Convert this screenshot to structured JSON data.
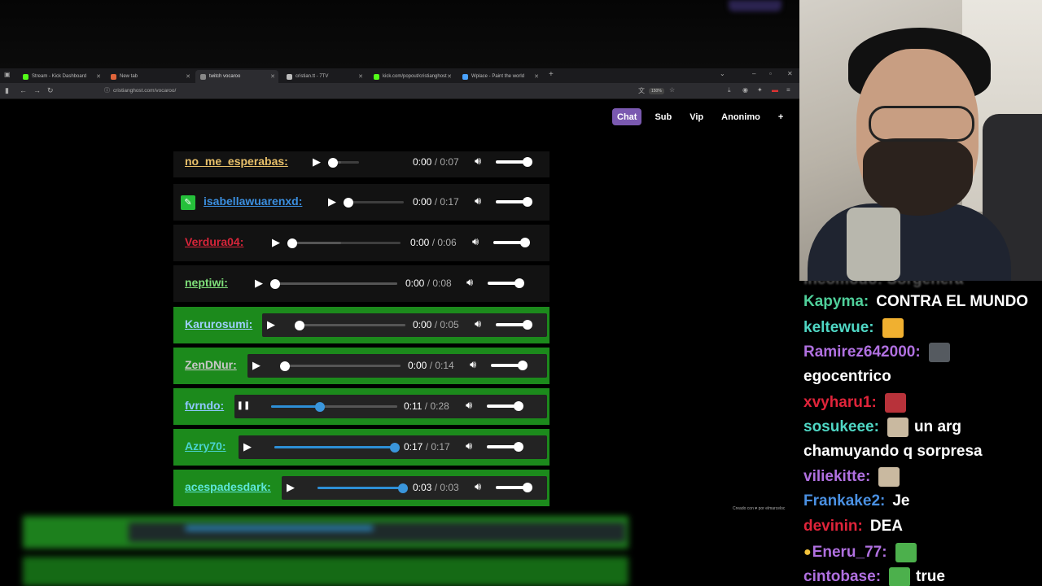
{
  "browser": {
    "tabs": [
      {
        "label": "Stream - Kick Dashboard",
        "color": "#53fc18"
      },
      {
        "label": "New tab",
        "color": "#e0643a"
      },
      {
        "label": "twitch vocaroo",
        "color": "#888888",
        "active": true
      },
      {
        "label": "cristian.tt - 7TV",
        "color": "#bbbbbb"
      },
      {
        "label": "kick.com/popout/cristianghost",
        "color": "#53fc18"
      },
      {
        "label": "Wplace - Paint the world",
        "color": "#4aa3ff"
      }
    ],
    "new_tab_glyph": "+",
    "url": "cristianghost.com/vocaroo/",
    "zoom": "150%"
  },
  "header_buttons": [
    {
      "label": "Chat",
      "active": true
    },
    {
      "label": "Sub",
      "active": false
    },
    {
      "label": "Vip",
      "active": false
    },
    {
      "label": "Anonimo",
      "active": false
    },
    {
      "label": "+",
      "active": false
    }
  ],
  "audio_rows": [
    {
      "user": "no_me_esperabas:",
      "user_color": "#e8c06a",
      "style": "dark",
      "state": "paused",
      "current": "0:00",
      "duration": "0:07",
      "progress": 0.0,
      "buffered": 0.3
    },
    {
      "user": "isabellawuarenxd:",
      "user_color": "#3b8fe0",
      "style": "dark",
      "badge": true,
      "state": "paused",
      "current": "0:00",
      "duration": "0:17",
      "progress": 0.0,
      "buffered": 0.0
    },
    {
      "user": "Verdura04:",
      "user_color": "#d8253a",
      "style": "dark",
      "state": "paused",
      "current": "0:00",
      "duration": "0:06",
      "progress": 0.0,
      "buffered": 0.45
    },
    {
      "user": "neptiwi:",
      "user_color": "#7fe07a",
      "style": "dark",
      "state": "paused",
      "current": "0:00",
      "duration": "0:08",
      "progress": 0.0,
      "buffered": 1.0
    },
    {
      "user": "Karurosumi:",
      "user_color": "#9fd0ff",
      "style": "green",
      "state": "paused",
      "current": "0:00",
      "duration": "0:05",
      "progress": 0.0,
      "buffered": 1.0
    },
    {
      "user": "ZenDNur:",
      "user_color": "#c8c8c8",
      "style": "green",
      "state": "paused",
      "current": "0:00",
      "duration": "0:14",
      "progress": 0.0,
      "buffered": 1.0
    },
    {
      "user": "fvrndo:",
      "user_color": "#8fc7ff",
      "style": "green",
      "state": "playing",
      "current": "0:11",
      "duration": "0:28",
      "progress": 0.39,
      "buffered": 1.0
    },
    {
      "user": "Azry70:",
      "user_color": "#4ad3d0",
      "style": "green",
      "state": "paused",
      "current": "0:17",
      "duration": "0:17",
      "progress": 1.0,
      "buffered": 1.0
    },
    {
      "user": "acespadesdark:",
      "user_color": "#5ee6d8",
      "style": "green",
      "state": "paused",
      "current": "0:03",
      "duration": "0:03",
      "progress": 1.0,
      "buffered": 1.0
    }
  ],
  "credit": "Creado con ♥ por elmarceloc",
  "chat": {
    "ghost": "Incomodo: Sorgenera",
    "messages": [
      {
        "user": "Kapyma:",
        "color": "#4fcf9a",
        "text": "CONTRA EL MUNDO"
      },
      {
        "user": "keltewue:",
        "color": "#4fd6c4",
        "text": "",
        "emote": "surprised-emote"
      },
      {
        "user": "Ramirez642000:",
        "color": "#b070e0",
        "text": "",
        "emote": "hooded-figure-emote"
      },
      {
        "user": "",
        "color": "#ffffff",
        "text": "egocentrico"
      },
      {
        "user": "xvyharu1:",
        "color": "#e0243a",
        "text": "",
        "emote": "red-mask-emote"
      },
      {
        "user": "sosukeee:",
        "color": "#4fd6c4",
        "text": "un arg",
        "emote": "che-emote"
      },
      {
        "user": "",
        "color": "#ffffff",
        "text": "chamuyando q sorpresa"
      },
      {
        "user": "viliekitte:",
        "color": "#b070e0",
        "text": "",
        "emote": "che-emote"
      },
      {
        "user": "Frankake2:",
        "color": "#4a90e2",
        "text": "Je"
      },
      {
        "user": "devinin:",
        "color": "#e0243a",
        "text": "DEA"
      },
      {
        "user": "Eneru_77:",
        "color": "#b070e0",
        "text": "",
        "emote": "green-face-emote",
        "prefix_emote": true
      },
      {
        "user": "cintobase:",
        "color": "#b070e0",
        "text": "true",
        "emote": "green-face-emote"
      }
    ]
  }
}
